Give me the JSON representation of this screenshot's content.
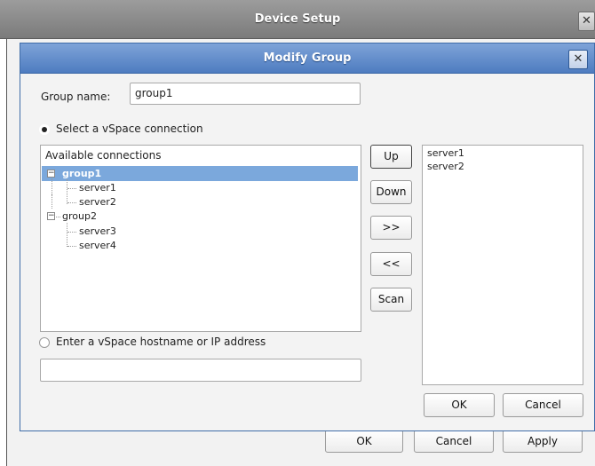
{
  "outer_window": {
    "title": "Device Setup",
    "close_glyph": "✕",
    "ok_label": "OK",
    "cancel_label": "Cancel",
    "apply_label": "Apply"
  },
  "dialog": {
    "title": "Modify Group",
    "close_glyph": "✕",
    "group_name_label": "Group name:",
    "group_name_value": "group1",
    "radio_vspace_connection_label": "Select a vSpace connection",
    "radio_vspace_connection_selected": true,
    "radio_hostname_label": "Enter a vSpace hostname or IP address",
    "radio_hostname_selected": false,
    "hostname_value": "",
    "available_header": "Available connections",
    "tree": [
      {
        "label": "group1",
        "expanded": true,
        "selected": true,
        "children": [
          "server1",
          "server2"
        ]
      },
      {
        "label": "group2",
        "expanded": true,
        "selected": false,
        "children": [
          "server3",
          "server4"
        ]
      }
    ],
    "buttons": {
      "up": "Up",
      "down": "Down",
      "add": ">>",
      "remove": "<<",
      "scan": "Scan",
      "ok": "OK",
      "cancel": "Cancel"
    },
    "selected_list": [
      "server1",
      "server2"
    ]
  },
  "colors": {
    "dialog_title_bar": "#5d88c8",
    "selection": "#7ba8dc",
    "outer_title_bar": "#8a8a8a"
  },
  "icons": {
    "expander_glyph": "−"
  }
}
